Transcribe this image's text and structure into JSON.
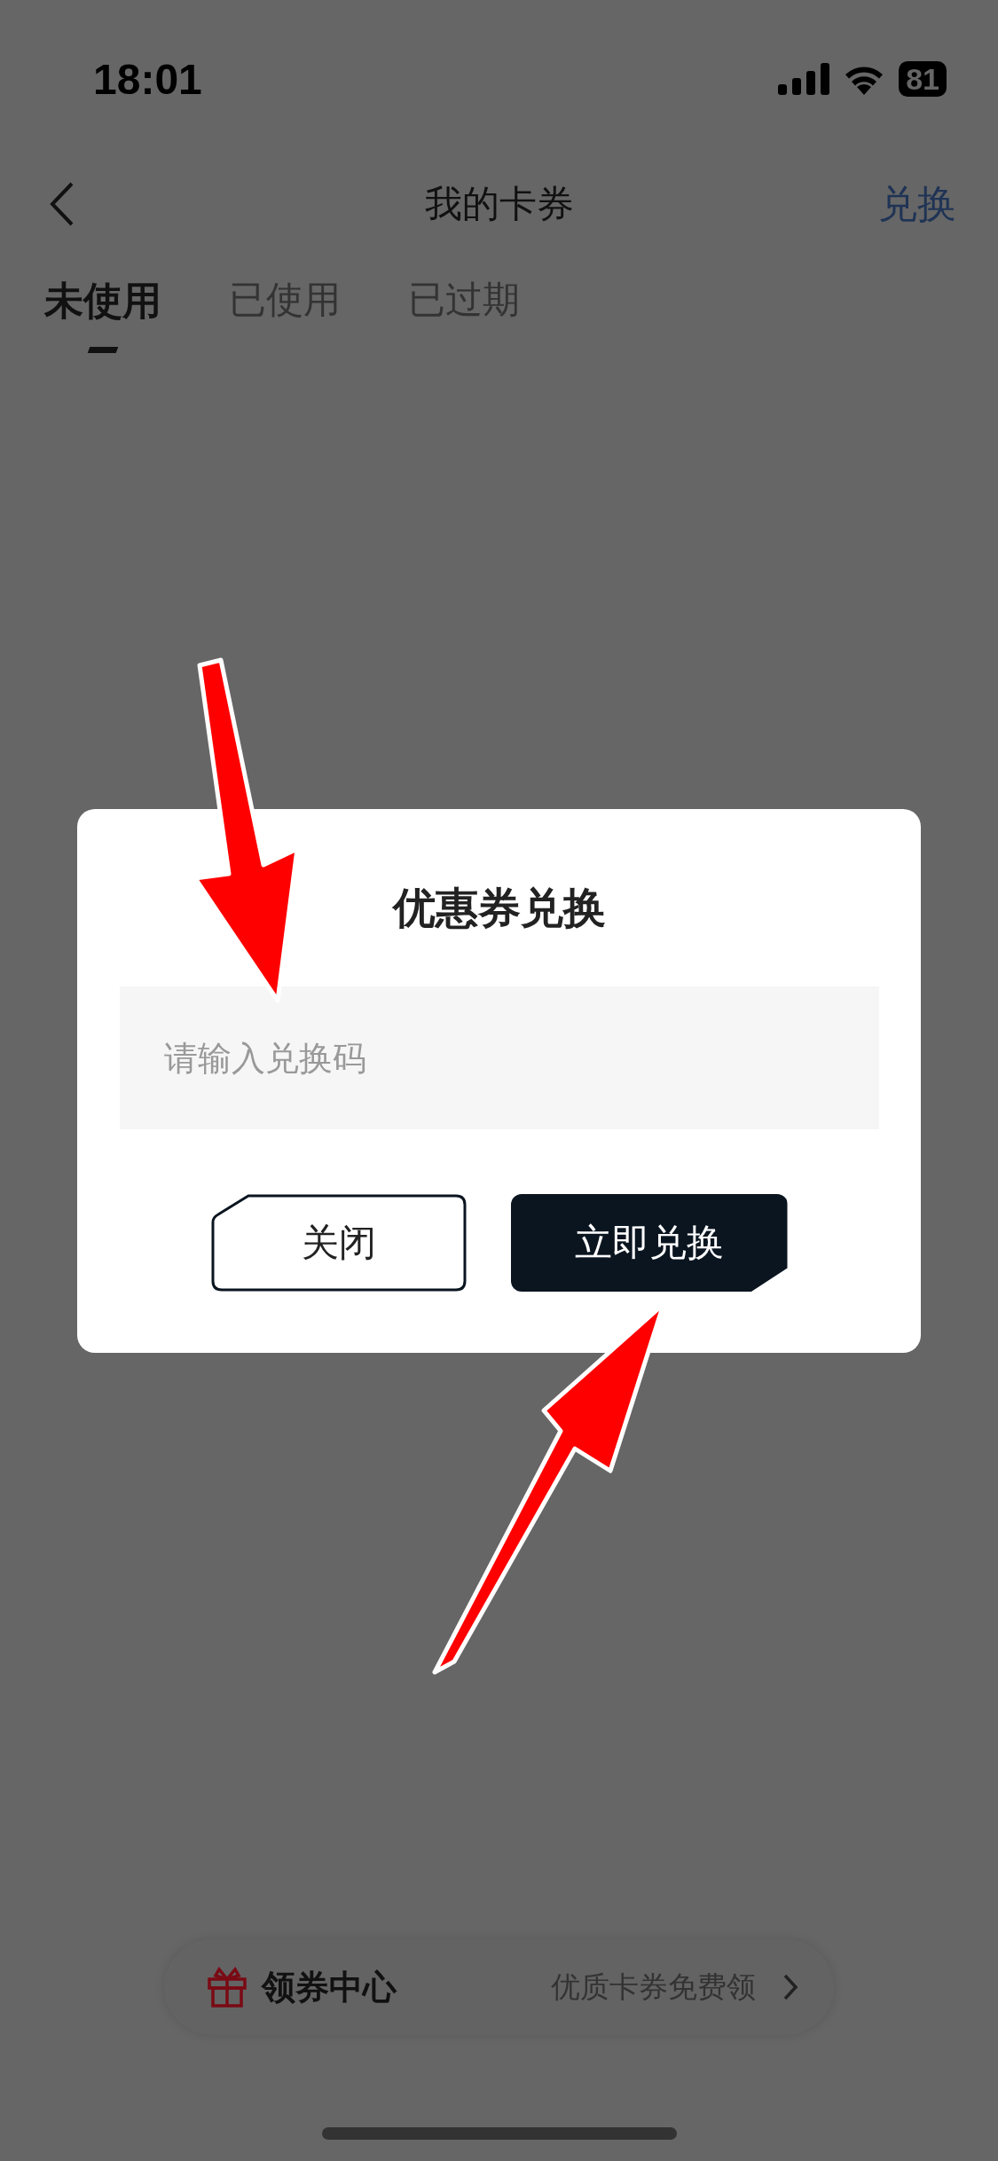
{
  "status_bar": {
    "time": "18:01",
    "battery": "81"
  },
  "header": {
    "title": "我的卡券",
    "action": "兑换"
  },
  "tabs": [
    {
      "label": "未使用",
      "selected": true
    },
    {
      "label": "已使用",
      "selected": false
    },
    {
      "label": "已过期",
      "selected": false
    }
  ],
  "dialog": {
    "title": "优惠券兑换",
    "input": {
      "placeholder": "请输入兑换码"
    },
    "buttons": [
      {
        "label": "关闭",
        "kind": "secondary"
      },
      {
        "label": "立即兑换",
        "kind": "primary"
      }
    ]
  },
  "coupon_center": {
    "title": "领券中心",
    "subtitle": "优质卡券免费领"
  }
}
